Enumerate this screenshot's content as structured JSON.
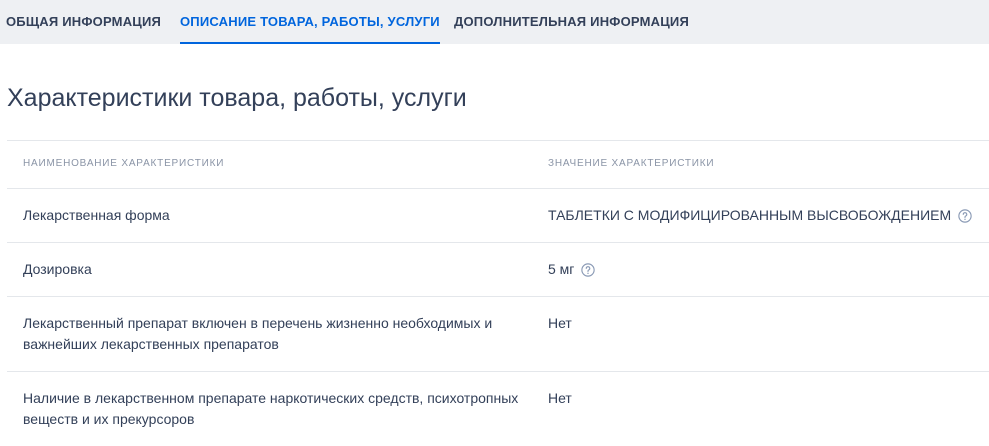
{
  "tabs": [
    {
      "label": "ОБЩАЯ ИНФОРМАЦИЯ",
      "active": false
    },
    {
      "label": "ОПИСАНИЕ ТОВАРА, РАБОТЫ, УСЛУГИ",
      "active": true
    },
    {
      "label": "ДОПОЛНИТЕЛЬНАЯ ИНФОРМАЦИЯ",
      "active": false
    }
  ],
  "section_title": "Характеристики товара, работы, услуги",
  "table": {
    "headers": {
      "name": "НАИМЕНОВАНИЕ ХАРАКТЕРИСТИКИ",
      "value": "ЗНАЧЕНИЕ ХАРАКТЕРИСТИКИ"
    },
    "rows": [
      {
        "name": "Лекарственная форма",
        "value": "ТАБЛЕТКИ С МОДИФИЦИРОВАННЫМ ВЫСВОБОЖДЕНИЕМ",
        "help_icon": "question-circle-icon"
      },
      {
        "name": "Дозировка",
        "value": "5 мг",
        "help_icon": "question-circle-icon"
      },
      {
        "name": "Лекарственный препарат включен в перечень жизненно необходимых и важнейших лекарственных препаратов",
        "value": "Нет"
      },
      {
        "name": "Наличие в лекарственном препарате наркотических средств, психотропных веществ и их прекурсоров",
        "value": "Нет"
      }
    ]
  },
  "colors": {
    "text": "#334059",
    "accent": "#0065dd",
    "tabs_background": "#eef0f3",
    "header_text": "#8a94a6",
    "icon": "#8a9ab5"
  }
}
